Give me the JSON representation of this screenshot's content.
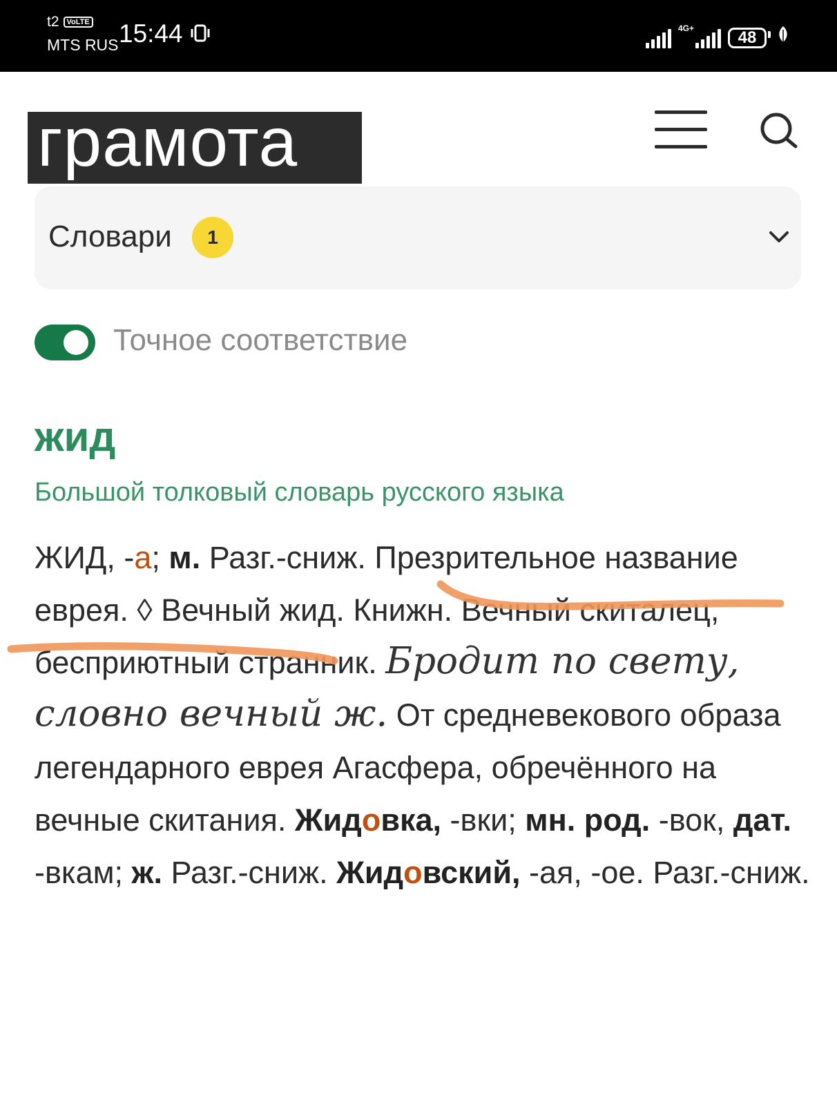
{
  "status_bar": {
    "carrier_top": "t2",
    "volte": "VoLTE",
    "carrier_bottom": "MTS RUS",
    "time": "15:44",
    "network": "4G+",
    "battery": "48",
    "icons": [
      "signal-icon",
      "signal-4g-icon",
      "battery-icon",
      "leaf-icon"
    ]
  },
  "header": {
    "logo": "грамота",
    "menu_icon": "hamburger-menu-icon",
    "search_icon": "search-icon"
  },
  "dictionaries": {
    "label": "Словари",
    "count": "1",
    "icon": "chevron-down-icon"
  },
  "exact_match": {
    "label": "Точное соответствие",
    "enabled": true,
    "color": "#157a47"
  },
  "entry": {
    "headword": "жид",
    "source": "Большой толковый словарь русского языка",
    "segments": {
      "s1": "ЖИД, -",
      "s2": "а",
      "s3": "; ",
      "s4": "м.",
      "s5": " Разг.-сниж. Презрительное название еврея. ◊ Вечный жид. Книжн. Вечный скиталец, бесприютный странник. ",
      "s6": "Бродит по свету, словно вечный ж.",
      "s7": " От средневекового образа легендарного еврея Агасфера, обречённого на вечные скитания. ",
      "s8": "Жид",
      "s9": "о",
      "s10": "вка,",
      "s11": " -вки; ",
      "s12": "мн. род.",
      "s13": " -вок, ",
      "s14": "дат.",
      "s15": " -вкам; ",
      "s16": "ж.",
      "s17": " Разг.-сниж. ",
      "s18": "Жид",
      "s19": "о",
      "s20": "вский,",
      "s21": " -ая, -ое. Разг.-сниж."
    },
    "stress_color": "#c0500f",
    "annotation_color": "#f0965a"
  }
}
